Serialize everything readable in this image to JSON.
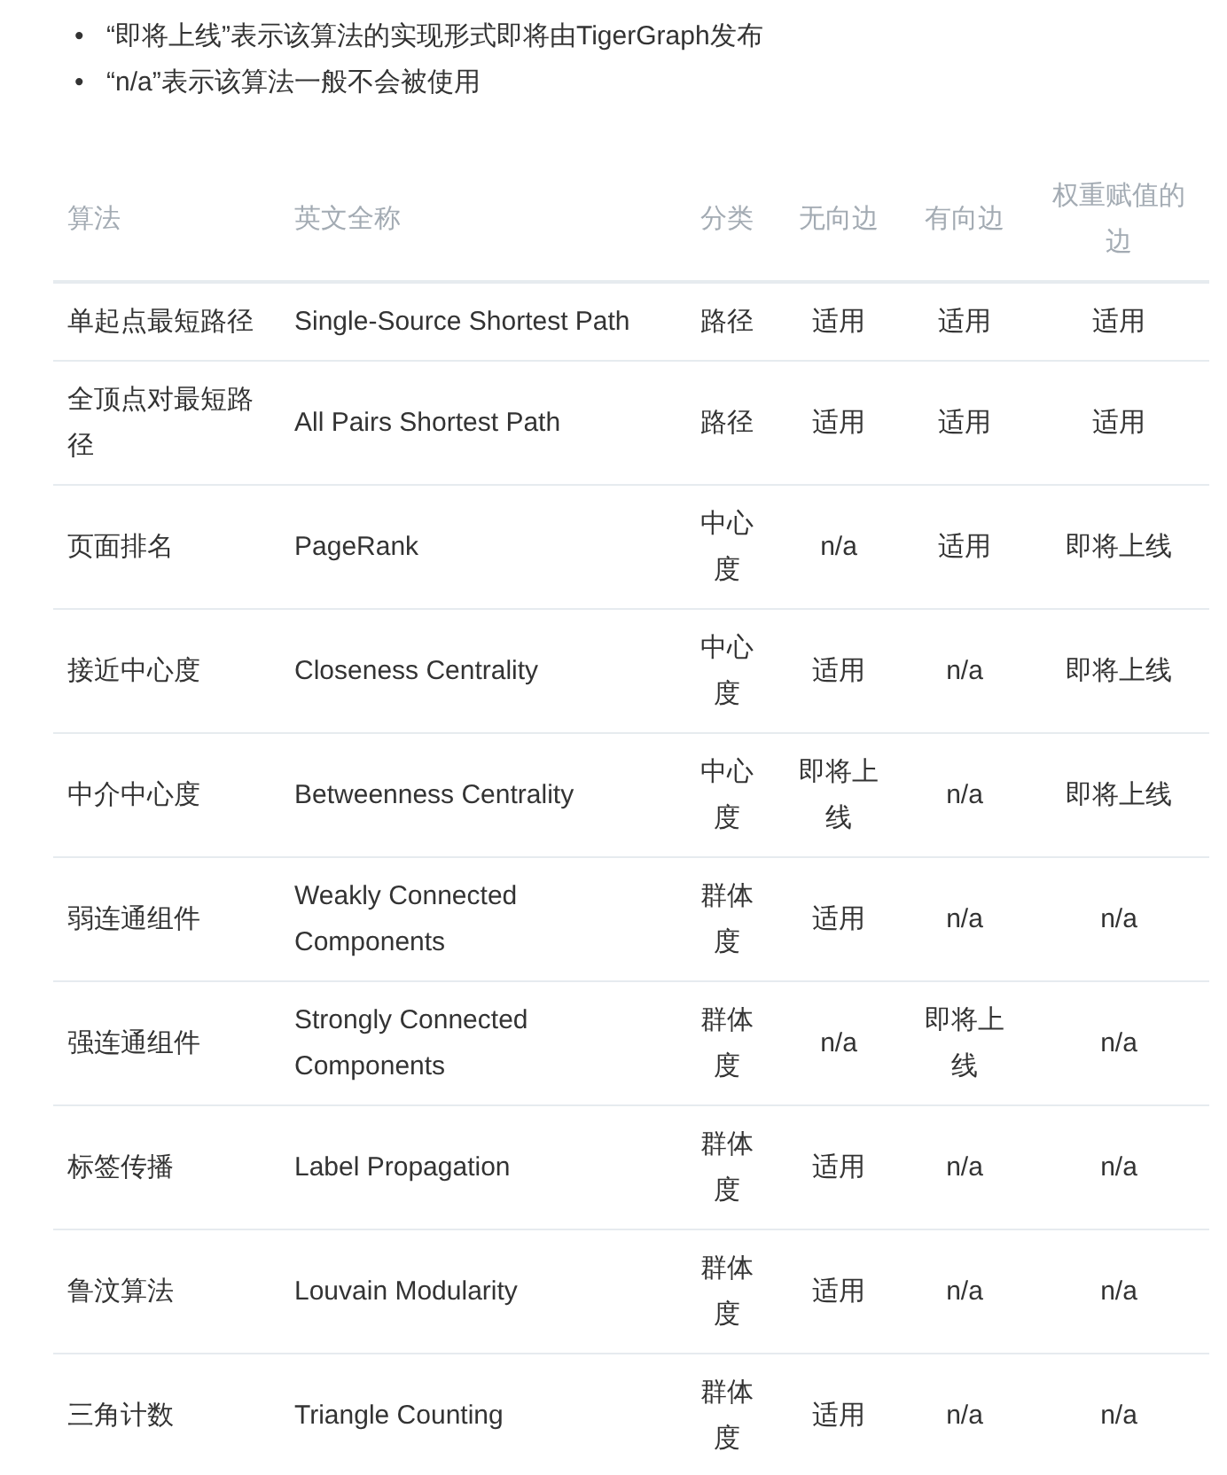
{
  "notes": [
    {
      "marker": "•",
      "text": "“即将上线”表示该算法的实现形式即将由TigerGraph发布"
    },
    {
      "marker": "•",
      "text": "“n/a”表示该算法一般不会被使用"
    }
  ],
  "table": {
    "columns": [
      "算法",
      "英文全称",
      "分类",
      "无向边",
      "有向边",
      "权重赋值的边"
    ],
    "rows": [
      [
        "单起点最短路径",
        "Single-Source Shortest Path",
        "路径",
        "适用",
        "适用",
        "适用"
      ],
      [
        "全顶点对最短路径",
        "All Pairs Shortest Path",
        "路径",
        "适用",
        "适用",
        "适用"
      ],
      [
        "页面排名",
        "PageRank",
        "中心度",
        "n/a",
        "适用",
        "即将上线"
      ],
      [
        "接近中心度",
        "Closeness Centrality",
        "中心度",
        "适用",
        "n/a",
        "即将上线"
      ],
      [
        "中介中心度",
        "Betweenness Centrality",
        "中心度",
        "即将上线",
        "n/a",
        "即将上线"
      ],
      [
        "弱连通组件",
        "Weakly Connected Components",
        "群体度",
        "适用",
        "n/a",
        "n/a"
      ],
      [
        "强连通组件",
        "Strongly Connected Components",
        "群体度",
        "n/a",
        "即将上线",
        "n/a"
      ],
      [
        "标签传播",
        "Label Propagation",
        "群体度",
        "适用",
        "n/a",
        "n/a"
      ],
      [
        "鲁汶算法",
        "Louvain Modularity",
        "群体度",
        "适用",
        "n/a",
        "n/a"
      ],
      [
        "三角计数",
        "Triangle Counting",
        "群体度",
        "适用",
        "n/a",
        "n/a"
      ]
    ]
  }
}
